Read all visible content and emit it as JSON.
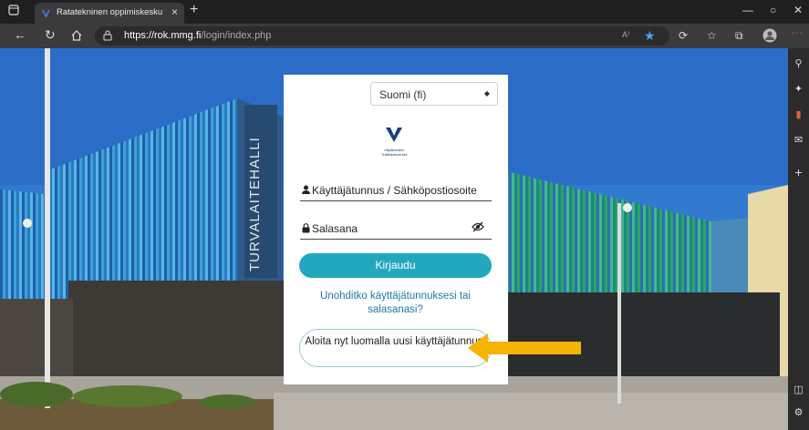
{
  "browser": {
    "tab_title": "Ratatekninen oppimiskeskus: Kir",
    "tab_close": "×",
    "new_tab": "+",
    "url_domain": "https://rok.mmg.fi",
    "url_path": "/login/index.php",
    "read_aloud": "A⁾",
    "win_min": "—",
    "win_max": "○",
    "win_close": "✕"
  },
  "login": {
    "language": "Suomi (fi)",
    "language_caret": "◆",
    "logo_line1": "Väylävirasto",
    "logo_line2": "Trafikledsverket",
    "username_placeholder": "Käyttäjätunnus / Sähköpostiosoite",
    "password_placeholder": "Salasana",
    "login_button": "Kirjaudu",
    "forgot_link": "Unohditko käyttäjätunnuksesi tai salasanasi?",
    "signup_button": "Aloita nyt luomalla uusi käyttäjätunnus!"
  },
  "building_sign": "TURVALAITEHALLI",
  "colors": {
    "accent": "#22a8bd",
    "link": "#1e7aa5",
    "arrow": "#f5b400"
  },
  "icons": [
    "browser-tab-icon",
    "back-icon",
    "refresh-icon",
    "home-icon",
    "lock-icon",
    "favorite-icon",
    "extensions-icon",
    "collections-icon",
    "profile-icon",
    "user-icon",
    "password-lock-icon",
    "eye-slash-icon",
    "arrow-icon"
  ]
}
